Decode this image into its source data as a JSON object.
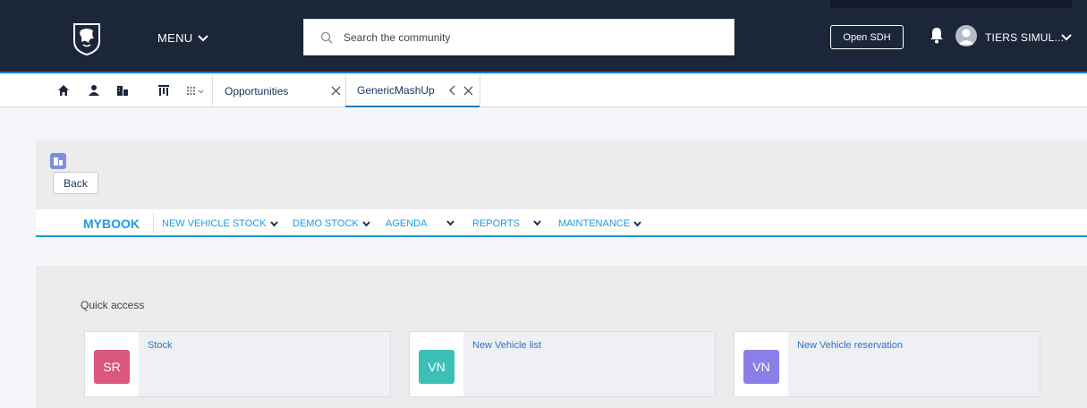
{
  "header": {
    "menu_label": "MENU",
    "search_placeholder": "Search the community",
    "open_sdh_label": "Open SDH",
    "user_name": "TIERS SIMUL..."
  },
  "tabs": {
    "items": [
      {
        "label": "Opportunities",
        "active": false
      },
      {
        "label": "GenericMashUp",
        "active": true
      }
    ]
  },
  "page": {
    "back_label": "Back"
  },
  "nav": {
    "brand": "MYBOOK",
    "items": [
      {
        "label": "NEW VEHICLE STOCK"
      },
      {
        "label": "DEMO STOCK"
      },
      {
        "label": "AGENDA"
      },
      {
        "label": "REPORTS"
      },
      {
        "label": "MAINTENANCE"
      }
    ]
  },
  "quick_access": {
    "title": "Quick access",
    "cards": [
      {
        "badge": "SR",
        "label": "Stock",
        "color": "#d9587b"
      },
      {
        "badge": "VN",
        "label": "New Vehicle list",
        "color": "#3cbfb5"
      },
      {
        "badge": "VN",
        "label": "New Vehicle reservation",
        "color": "#8b7ee8"
      }
    ]
  },
  "colors": {
    "header_bg": "#1b2638",
    "accent_blue": "#1f9ae0",
    "link_blue": "#2a73c9"
  },
  "icons": {
    "logo": "lion-logo",
    "search": "search-icon",
    "bell": "bell-icon",
    "avatar": "user-avatar-icon",
    "home": "home-icon",
    "person": "person-icon",
    "buildings": "buildings-icon",
    "board": "board-icon",
    "apps": "apps-grid-icon",
    "close": "close-icon",
    "back": "chevron-left-icon"
  }
}
